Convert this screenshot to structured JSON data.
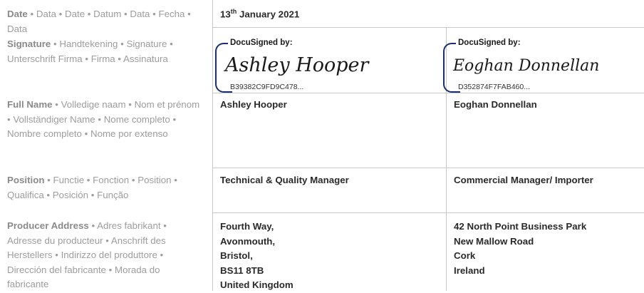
{
  "labels": {
    "date": {
      "title": "Date",
      "rest": "• Data • Date • Datum • Data • Fecha • Data"
    },
    "signature": {
      "title": "Signature",
      "rest": "• Handtekening • Signature • Unterschrift Firma • Firma • Assinatura"
    },
    "full_name": {
      "title": "Full Name",
      "rest": "• Volledige naam • Nom et prénom • Vollständiger Name • Nome completo • Nombre completo • Nome por extenso"
    },
    "position": {
      "title": "Position",
      "rest": "• Functie • Fonction • Position • Qualifica • Posición • Função"
    },
    "producer_address": {
      "title": "Producer Address",
      "rest": "• Adres fabrikant • Adresse du producteur • Anschrift des Herstellers • Indirizzo del produttore • Dirección del fabricante • Morada do fabricante"
    }
  },
  "date": {
    "day": "13",
    "suffix": "th",
    "rest": " January 2021"
  },
  "signer1": {
    "docusign_header": "DocuSigned by:",
    "signature_script": "Ashley Hooper",
    "envelope_code": "B39382C9FD9C478...",
    "name": "Ashley Hooper",
    "position": "Technical & Quality Manager",
    "address": [
      "Fourth Way,",
      "Avonmouth,",
      "Bristol,",
      "BS11 8TB",
      "United Kingdom"
    ]
  },
  "signer2": {
    "docusign_header": "DocuSigned by:",
    "signature_script": "Eoghan Donnellan",
    "envelope_code": "D352874F7FAB460...",
    "name": "Eoghan Donnellan",
    "position": "Commercial Manager/ Importer",
    "address": [
      "42 North Point Business Park",
      "New Mallow Road",
      "Cork",
      "Ireland"
    ]
  }
}
